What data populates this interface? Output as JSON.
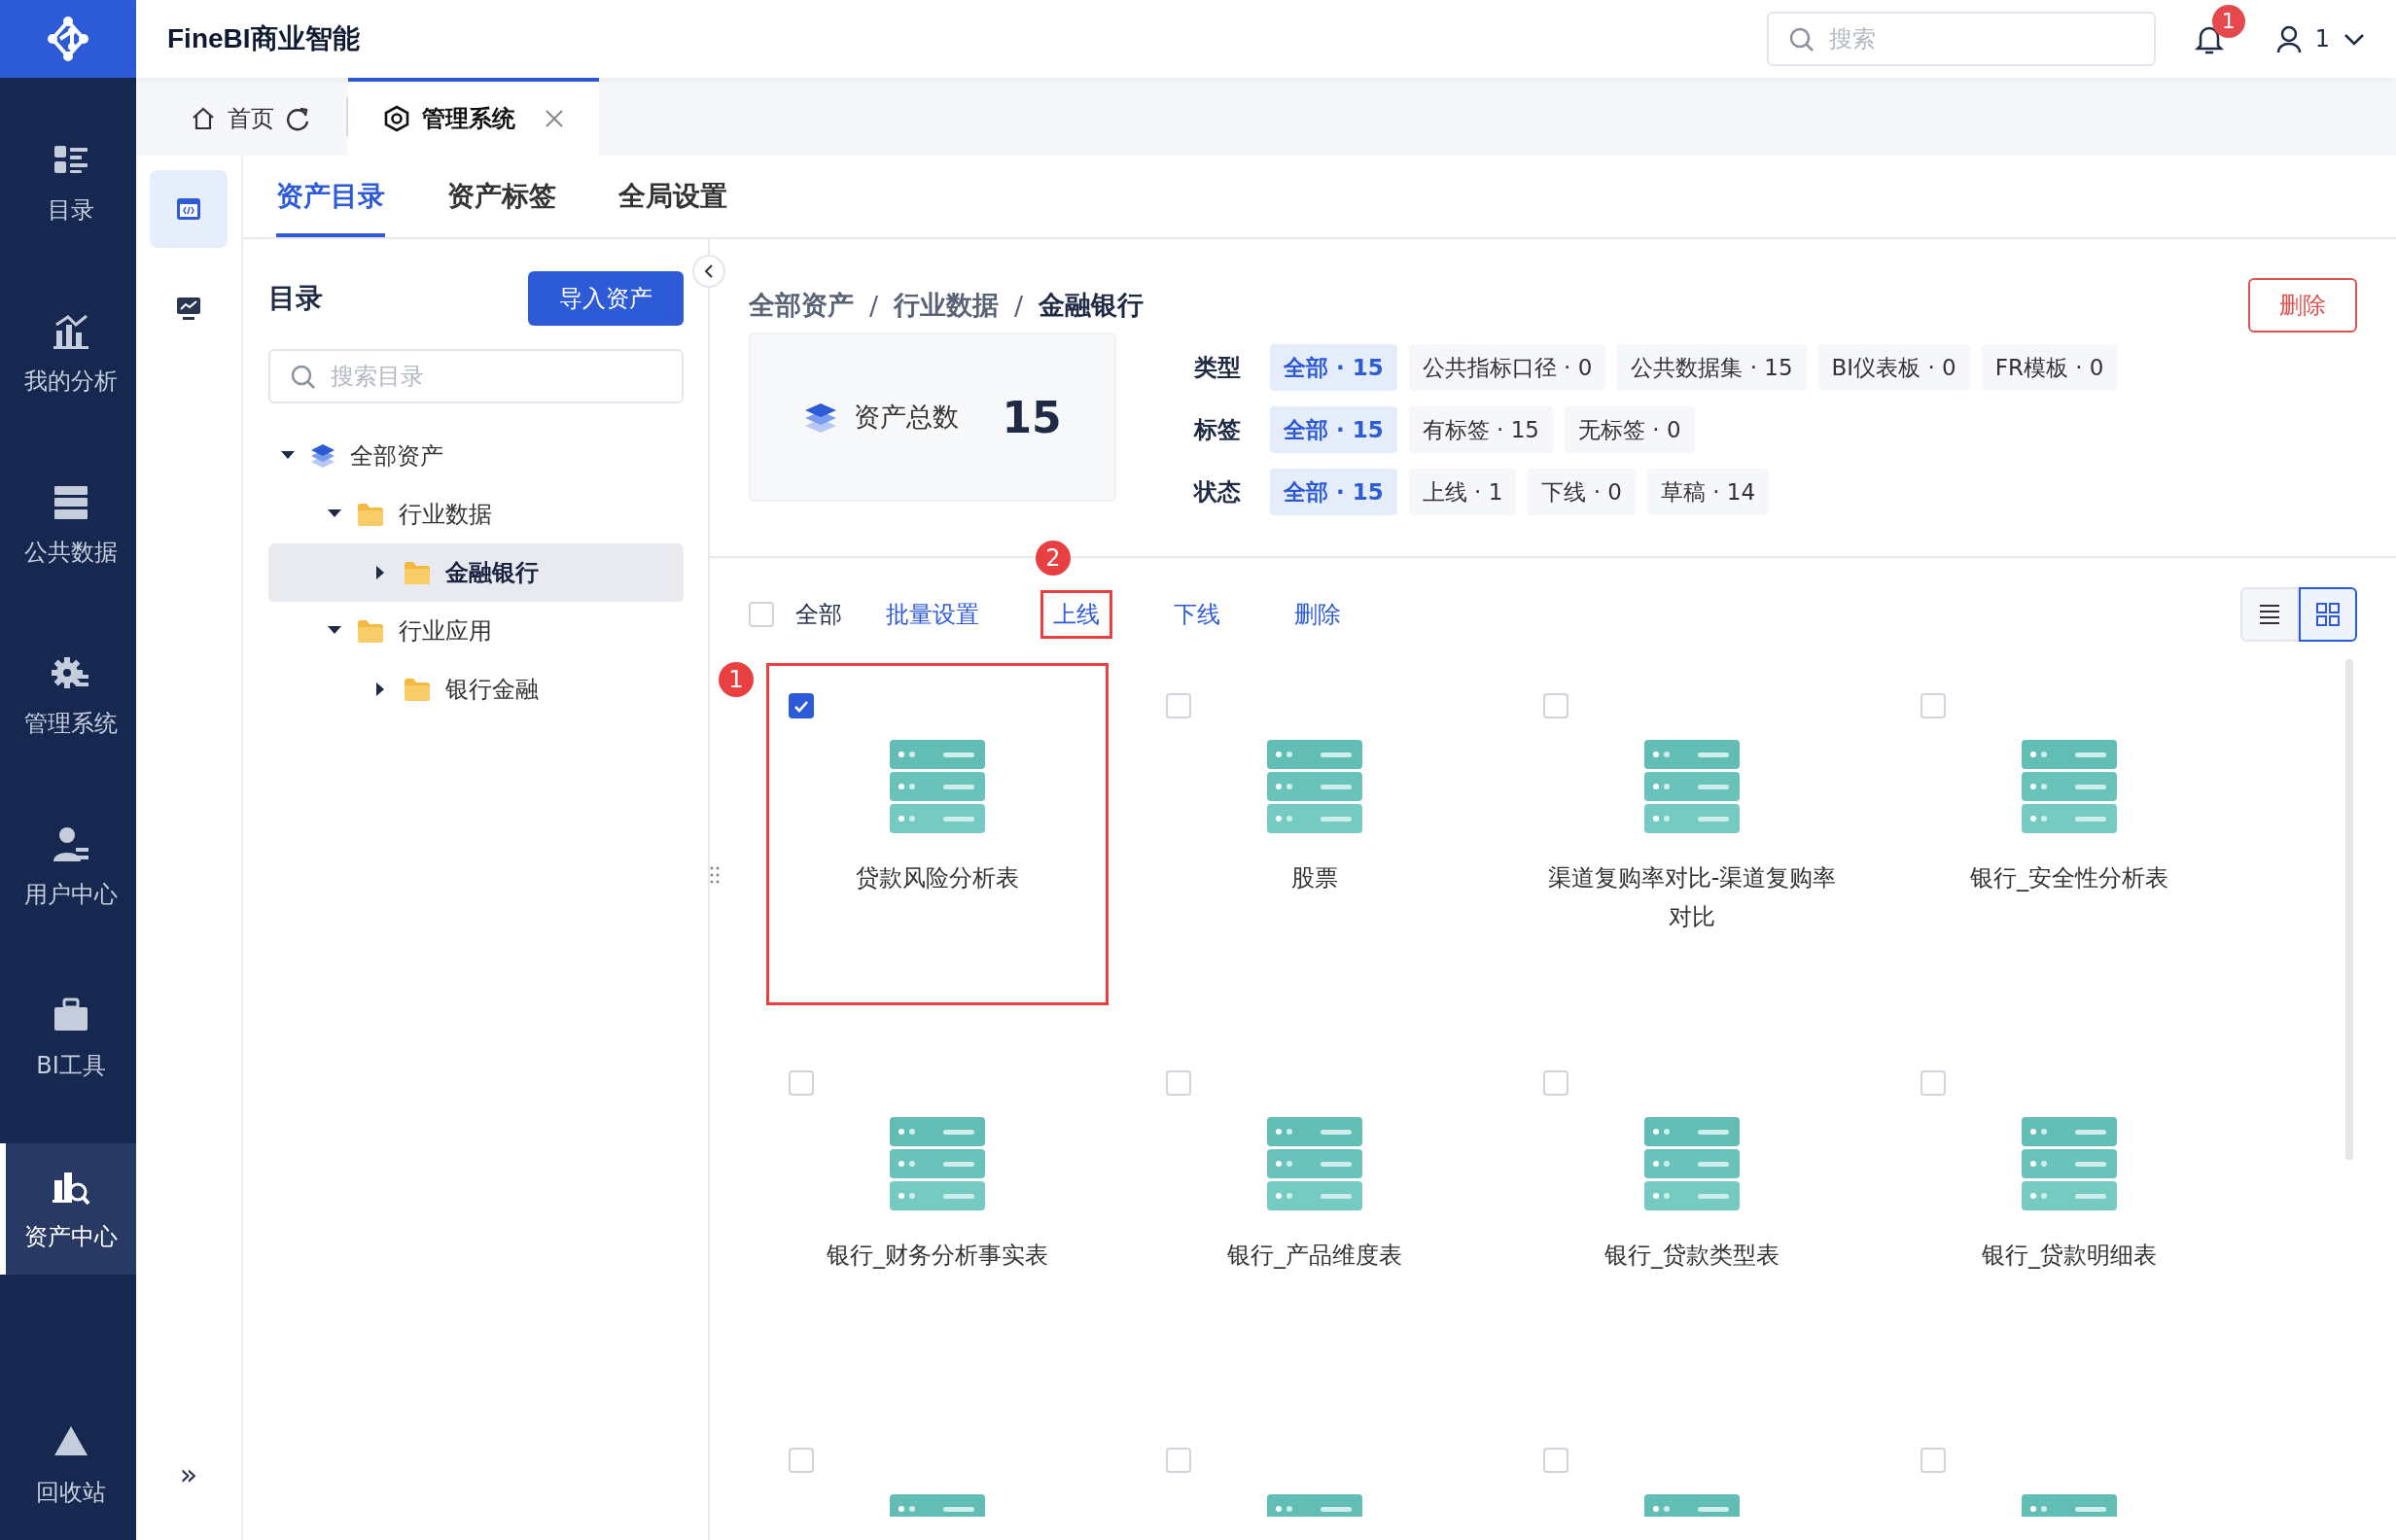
{
  "app": {
    "title": "FineBI商业智能"
  },
  "nav": {
    "items": [
      {
        "kind": "catalog",
        "label": "目录",
        "selected": false
      },
      {
        "kind": "analysis",
        "label": "我的分析",
        "selected": false
      },
      {
        "kind": "data",
        "label": "公共数据",
        "selected": false
      },
      {
        "kind": "system",
        "label": "管理系统",
        "selected": false
      },
      {
        "kind": "user",
        "label": "用户中心",
        "selected": false
      },
      {
        "kind": "tools",
        "label": "BI工具",
        "selected": false
      },
      {
        "kind": "asset",
        "label": "资产中心",
        "selected": true
      }
    ],
    "bottom": {
      "kind": "recycle",
      "label": "回收站"
    },
    "expand": "»"
  },
  "header": {
    "search": {
      "placeholder": "搜索"
    },
    "notifications": {
      "count": "1"
    },
    "user": {
      "name": "1"
    }
  },
  "page_tabs": [
    {
      "kind": "home",
      "label": "首页",
      "selected": false
    },
    {
      "kind": "system",
      "label": "管理系统",
      "selected": true
    }
  ],
  "side_tools": [
    {
      "kind": "catalog",
      "selected": true
    },
    {
      "kind": "monitor",
      "selected": false
    }
  ],
  "sub_tabs": [
    {
      "label": "资产目录",
      "selected": true
    },
    {
      "label": "资产标签",
      "selected": false
    },
    {
      "label": "全局设置",
      "selected": false
    }
  ],
  "catalog_panel": {
    "title": "目录",
    "import_button": "导入资产",
    "search": {
      "placeholder": "搜索目录"
    },
    "tree": [
      {
        "kind": "root",
        "label": "全部资产",
        "expanded": true,
        "selected": false,
        "children": [
          {
            "kind": "folder",
            "label": "行业数据",
            "expanded": true,
            "selected": false,
            "children": [
              {
                "kind": "folder",
                "label": "金融银行",
                "expanded": false,
                "selected": true
              }
            ]
          },
          {
            "kind": "folder",
            "label": "行业应用",
            "expanded": true,
            "selected": false,
            "children": [
              {
                "kind": "folder",
                "label": "银行金融",
                "expanded": false,
                "selected": false
              }
            ]
          }
        ]
      }
    ]
  },
  "breadcrumb": {
    "items": [
      "全部资产",
      "行业数据",
      "金融银行"
    ],
    "separator": "/"
  },
  "delete_button": "删除",
  "summary": {
    "label": "资产总数",
    "value": "15"
  },
  "filters": [
    {
      "label": "类型",
      "options": [
        {
          "label": "全部 · 15",
          "selected": true
        },
        {
          "label": "公共指标口径 · 0",
          "selected": false
        },
        {
          "label": "公共数据集 · 15",
          "selected": false
        },
        {
          "label": "BI仪表板 · 0",
          "selected": false
        },
        {
          "label": "FR模板 · 0",
          "selected": false
        }
      ]
    },
    {
      "label": "标签",
      "options": [
        {
          "label": "全部 · 15",
          "selected": true
        },
        {
          "label": "有标签 · 15",
          "selected": false
        },
        {
          "label": "无标签 · 0",
          "selected": false
        }
      ]
    },
    {
      "label": "状态",
      "options": [
        {
          "label": "全部 · 15",
          "selected": true
        },
        {
          "label": "上线 · 1",
          "selected": false
        },
        {
          "label": "下线 · 0",
          "selected": false
        },
        {
          "label": "草稿 · 14",
          "selected": false
        }
      ]
    }
  ],
  "toolbar": {
    "select_all": {
      "label": "全部",
      "checked": false
    },
    "actions": [
      {
        "label": "批量设置",
        "highlight": false
      },
      {
        "label": "上线",
        "highlight": true,
        "marker": "2"
      },
      {
        "label": "下线",
        "highlight": false
      },
      {
        "label": "删除",
        "highlight": false
      }
    ],
    "view_modes": [
      {
        "kind": "list",
        "selected": false
      },
      {
        "kind": "grid",
        "selected": true
      }
    ]
  },
  "assets": [
    {
      "name": "贷款风险分析表",
      "checked": true,
      "highlight": true,
      "marker": "1"
    },
    {
      "name": "股票",
      "checked": false,
      "highlight": false
    },
    {
      "name": "渠道复购率对比-渠道复购率对比",
      "checked": false,
      "highlight": false
    },
    {
      "name": "银行_安全性分析表",
      "checked": false,
      "highlight": false
    },
    {
      "name": "银行_财务分析事实表",
      "checked": false,
      "highlight": false
    },
    {
      "name": "银行_产品维度表",
      "checked": false,
      "highlight": false
    },
    {
      "name": "银行_贷款类型表",
      "checked": false,
      "highlight": false
    },
    {
      "name": "银行_贷款明细表",
      "checked": false,
      "highlight": false
    },
    {
      "checked": false,
      "highlight": false
    },
    {
      "checked": false,
      "highlight": false
    },
    {
      "checked": false,
      "highlight": false
    },
    {
      "checked": false,
      "highlight": false
    }
  ]
}
